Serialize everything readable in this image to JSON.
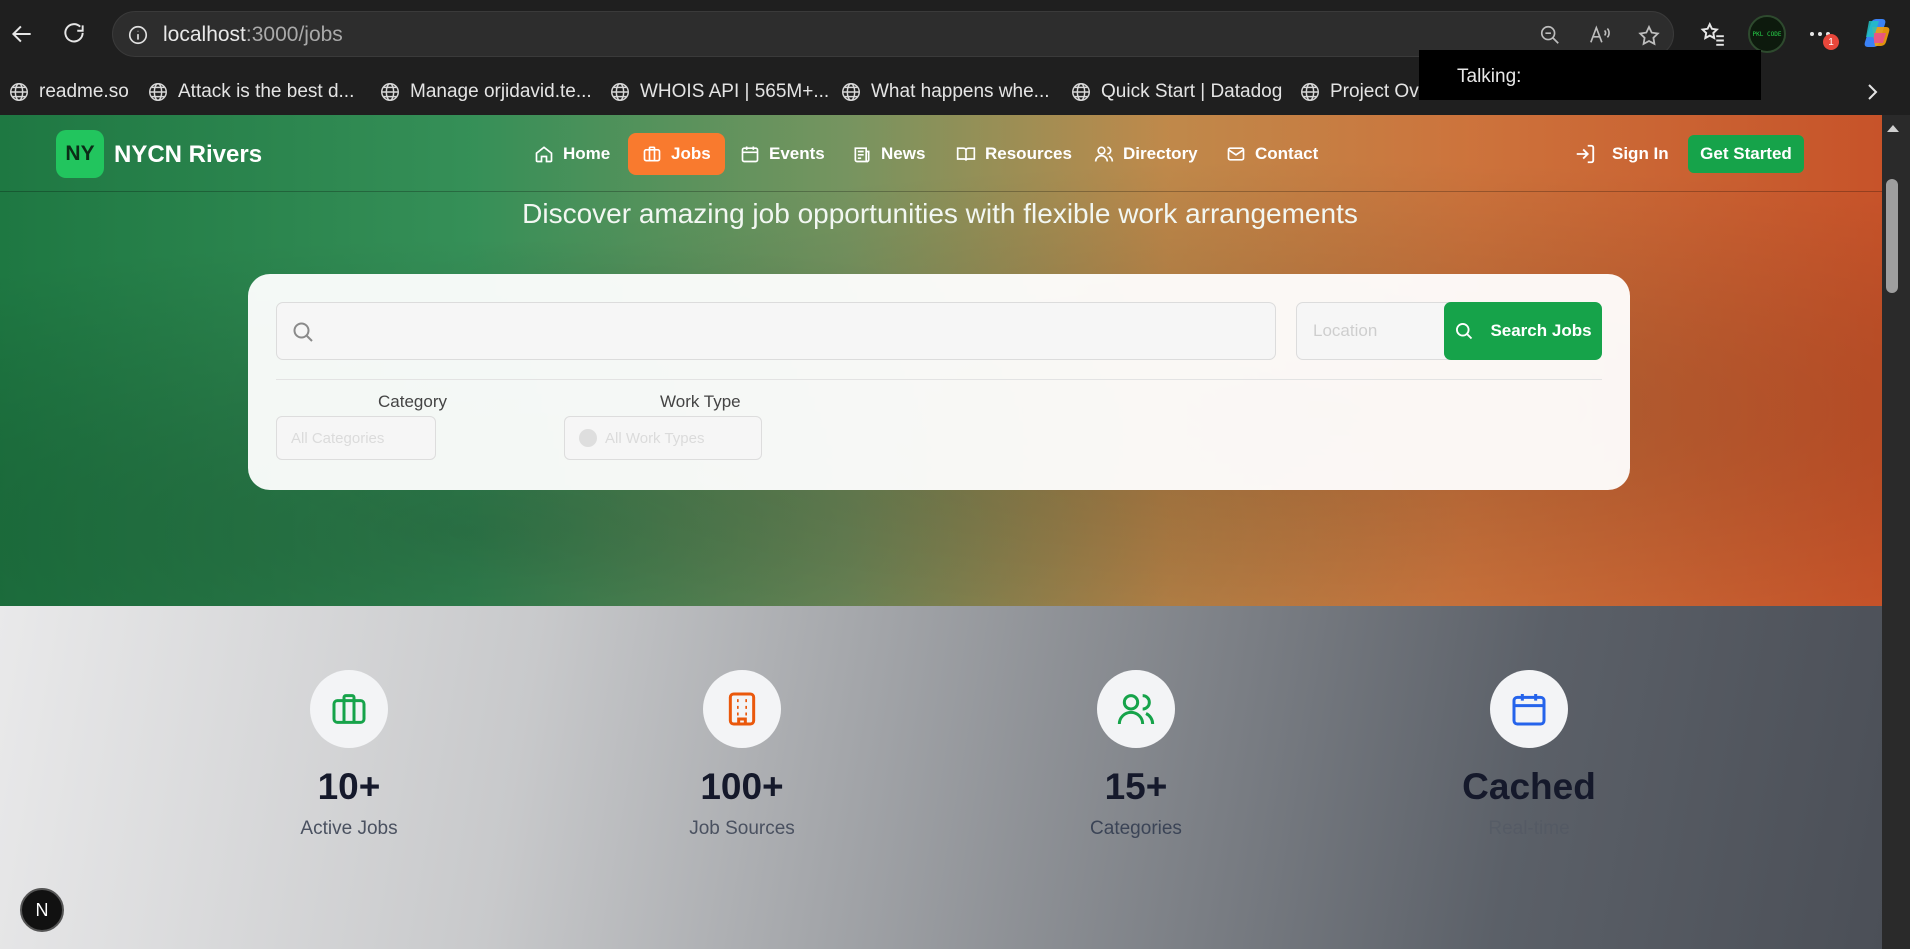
{
  "browser": {
    "url_host": "localhost",
    "url_path": ":3000/jobs",
    "bookmarks": [
      "readme.so",
      "Attack is the best d...",
      "Manage orjidavid.te...",
      "WHOIS API | 565M+...",
      "What happens whe...",
      "Quick Start | Datadog",
      "Project Ove"
    ],
    "profile_text": "PKL CODE",
    "notification_count": "1",
    "talking_label": "Talking:"
  },
  "site": {
    "logo_mark": "NY",
    "logo_name": "NYCN Rivers",
    "nav": [
      "Home",
      "Jobs",
      "Events",
      "News",
      "Resources",
      "Directory",
      "Contact"
    ],
    "active_nav": "Jobs",
    "sign_in": "Sign In",
    "get_started": "Get Started"
  },
  "hero": {
    "subtitle": "Discover amazing job opportunities with flexible work arrangements"
  },
  "search": {
    "keyword_placeholder": "",
    "location_placeholder": "Location",
    "button": "Search Jobs",
    "category_label": "Category",
    "category_value": "All Categories",
    "work_type_label": "Work Type",
    "work_type_value": "All Work Types"
  },
  "stats": [
    {
      "value": "10+",
      "label": "Active Jobs",
      "icon": "briefcase-icon",
      "color": "#16a34a"
    },
    {
      "value": "100+",
      "label": "Job Sources",
      "icon": "building-icon",
      "color": "#ea580c"
    },
    {
      "value": "15+",
      "label": "Categories",
      "icon": "users-icon",
      "color": "#16a34a"
    },
    {
      "value": "Cached",
      "label": "Real-time",
      "icon": "calendar-icon",
      "color": "#2563eb"
    }
  ],
  "dev_badge": "N"
}
